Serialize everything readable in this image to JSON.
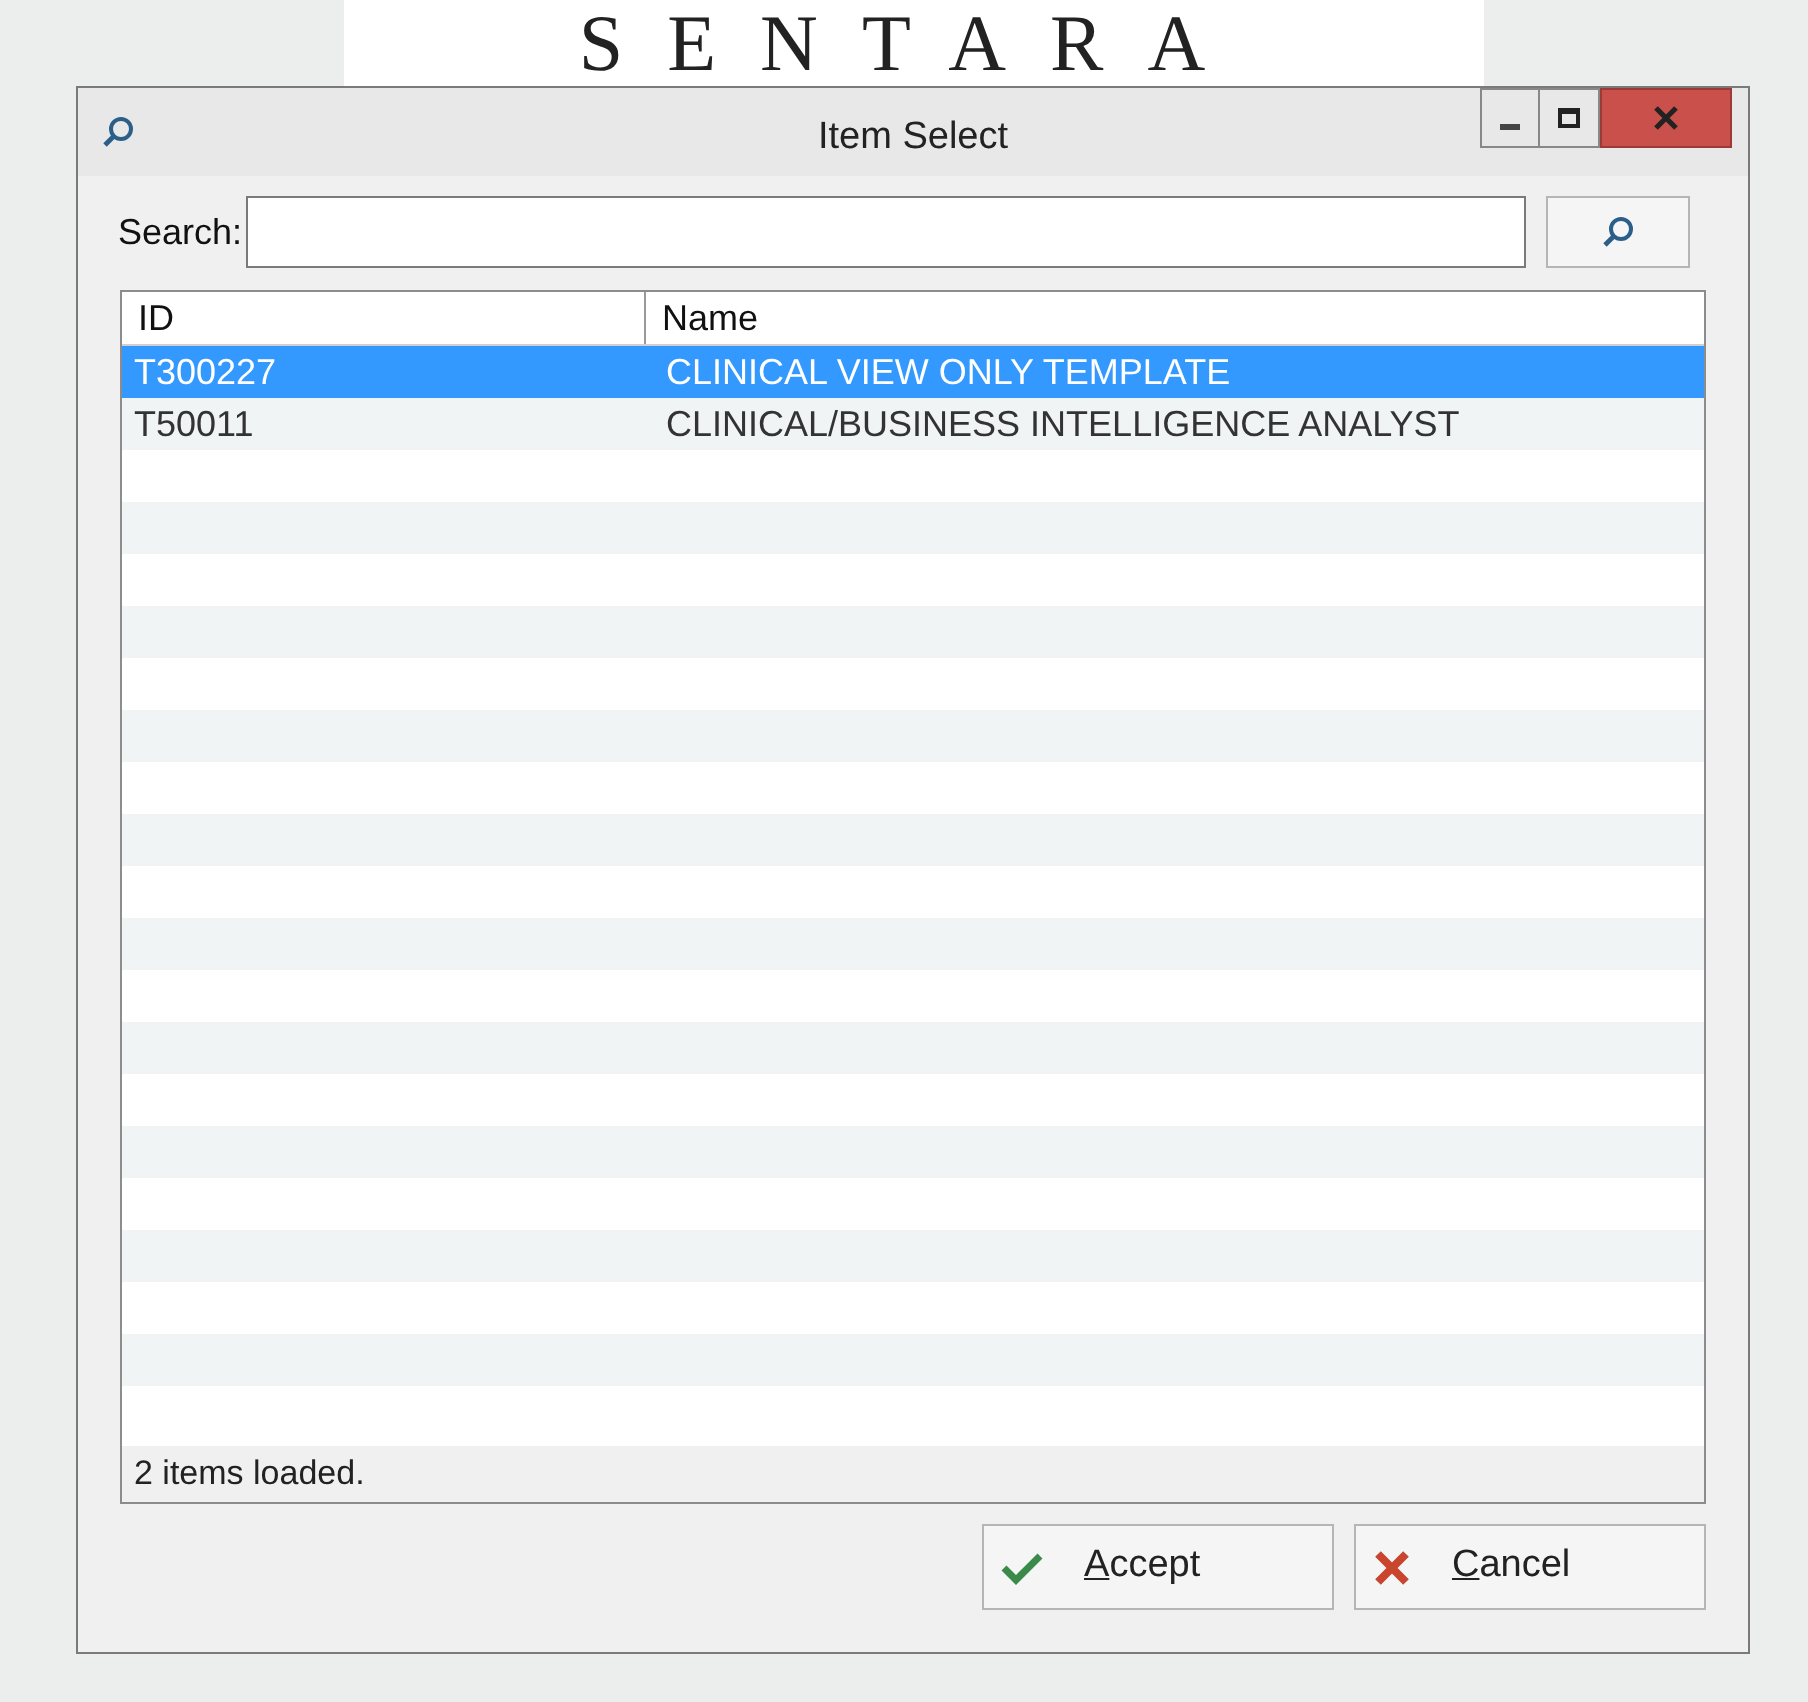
{
  "background_logo": "SENTARA",
  "window": {
    "title": "Item Select"
  },
  "search": {
    "label": "Search:"
  },
  "table": {
    "columns": [
      "ID",
      "Name"
    ],
    "rows": [
      {
        "id": "T300227",
        "name": "CLINICAL VIEW ONLY TEMPLATE",
        "selected": true
      },
      {
        "id": "T50011",
        "name": "CLINICAL/BUSINESS INTELLIGENCE ANALYST",
        "selected": false
      }
    ]
  },
  "status": "2 items loaded.",
  "buttons": [
    {
      "kind": "accept",
      "label": "Accept"
    },
    {
      "kind": "cancel",
      "label": "Cancel"
    }
  ]
}
